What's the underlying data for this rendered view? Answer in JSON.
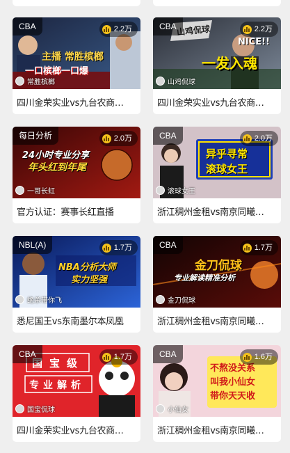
{
  "cards": [
    {
      "tag": "CBA",
      "views": "2.2万",
      "anchor": "常胜槟榔",
      "title": "四川金荣实业vs九台农商…",
      "overlay1": "主播 常胜槟榔",
      "overlay2": "一口槟榔一口爆"
    },
    {
      "tag": "CBA",
      "views": "2.2万",
      "anchor": "山鸡侃球",
      "title": "四川金荣实业vs九台农商…",
      "overlay1": "山鸡侃球",
      "overlay2": "一发入魂",
      "overlay3": "NICE!!"
    },
    {
      "tag": "每日分析",
      "views": "2.0万",
      "anchor": "一哥长虹",
      "title": "官方认证：赛事长红直播",
      "overlay1": "24小时专业分享",
      "overlay2": "年头红到年尾"
    },
    {
      "tag": "CBA",
      "views": "2.0万",
      "anchor": "滚球女王",
      "title": "浙江稠州金租vs南京同曦…",
      "overlay1": "异乎寻常",
      "overlay2": "滚球女王"
    },
    {
      "tag": "NBL(A)",
      "views": "1.7万",
      "anchor": "绝杀带你飞",
      "title": "悉尼国王vs东南墨尔本凤凰",
      "overlay1": "NBA分析大师",
      "overlay2": "实力坚强"
    },
    {
      "tag": "CBA",
      "views": "1.7万",
      "anchor": "金刀侃球",
      "title": "浙江稠州金租vs南京同曦…",
      "overlay1": "金刀侃球",
      "overlay2": "专业解读精准分析"
    },
    {
      "tag": "CBA",
      "views": "1.7万",
      "anchor": "国宝侃球",
      "title": "四川金荣实业vs九台农商…",
      "overlay1": "国宝级",
      "overlay2": "专业解析"
    },
    {
      "tag": "CBA",
      "views": "1.6万",
      "anchor": "小仙女",
      "title": "浙江稠州金租vs南京同曦…",
      "overlay1": "不熬没关系",
      "overlay2": "叫我小仙女",
      "overlay3": "带你天天收"
    }
  ],
  "colors": {
    "background": "#efefef",
    "card": "#ffffff",
    "hot_badge": "#f4c21b"
  },
  "icons": {
    "views": "bar-chart-icon"
  }
}
